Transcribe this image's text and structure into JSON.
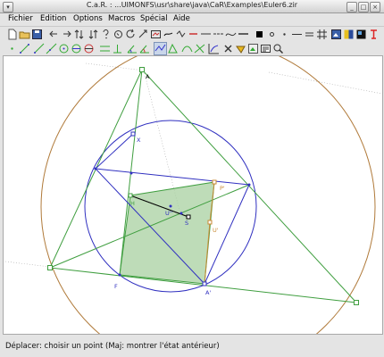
{
  "window": {
    "title": "C.a.R. : ...UIMONFS\\usr\\share\\java\\CaR\\Examples\\Euler6.zir"
  },
  "titlebar_buttons": [
    "menu",
    "minimize",
    "maximize",
    "close"
  ],
  "menu": [
    "Fichier",
    "Edition",
    "Options",
    "Macros",
    "Spécial",
    "Aide"
  ],
  "toolbar1_icons": [
    "new-file",
    "open-file",
    "save",
    "undo",
    "redo",
    "hide",
    "show",
    "help",
    "question",
    "rotate",
    "zoom",
    "grid",
    "color-black",
    "color-red",
    "color-green",
    "color-blue",
    "line-style",
    "curve",
    "toggle-names",
    "square-black",
    "point-small",
    "dot",
    "line-thin",
    "equal",
    "hash",
    "palette-blue",
    "palette-yellow",
    "palette-black",
    "text-red"
  ],
  "toolbar2_icons": [
    "point",
    "segment",
    "ray",
    "line",
    "circle",
    "circle-3",
    "circle-fixed",
    "parallel",
    "perpendicular",
    "angle",
    "fixed-angle",
    "move-tool",
    "polygon",
    "conic",
    "area",
    "function",
    "delete",
    "hide-tool",
    "zoom-tool",
    "macro",
    "tools"
  ],
  "toolbar2_selected": "move-tool",
  "geometry": {
    "labels": [
      "A",
      "X",
      "H",
      "U''",
      "S",
      "P'",
      "U'",
      "F",
      "A'"
    ],
    "colors": {
      "triangle": "#3f9e3f",
      "circle": "#3030c0",
      "orange": "#c98a35",
      "fill": "#a8d0a0"
    }
  },
  "status": {
    "text": "Déplacer: choisir un point (Maj: montrer l'état antérieur)"
  }
}
